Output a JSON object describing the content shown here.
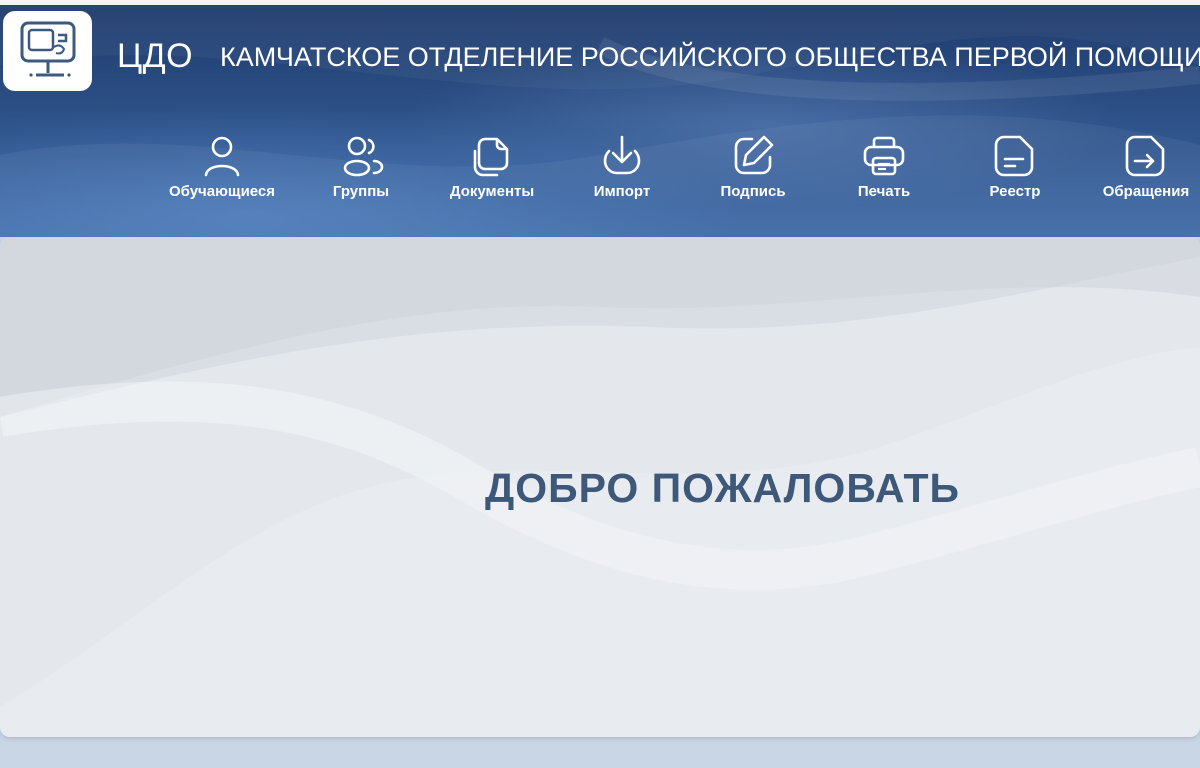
{
  "header": {
    "app_name": "ЦДО",
    "org_name": "КАМЧАТСКОЕ ОТДЕЛЕНИЕ РОССИЙСКОГО ОБЩЕСТВА ПЕРВОЙ ПОМОЩИ",
    "logo_icon": "computer-monitor-icon"
  },
  "nav": {
    "items": [
      {
        "label": "Обучающиеся",
        "icon": "user-icon"
      },
      {
        "label": "Группы",
        "icon": "users-icon"
      },
      {
        "label": "Документы",
        "icon": "documents-icon"
      },
      {
        "label": "Импорт",
        "icon": "download-icon"
      },
      {
        "label": "Подпись",
        "icon": "edit-pen-icon"
      },
      {
        "label": "Печать",
        "icon": "printer-icon"
      },
      {
        "label": "Реестр",
        "icon": "registry-note-icon"
      },
      {
        "label": "Обращения",
        "icon": "request-arrow-icon"
      }
    ]
  },
  "main": {
    "welcome_text": "ДОБРО ПОЖАЛОВАТЬ"
  },
  "colors": {
    "header_dark": "#1f3c6d",
    "header_light": "#3f6aa7",
    "card_bg": "#e3e7ec",
    "welcome_text": "#3d5878",
    "page_bg": "#c9d6e6"
  }
}
